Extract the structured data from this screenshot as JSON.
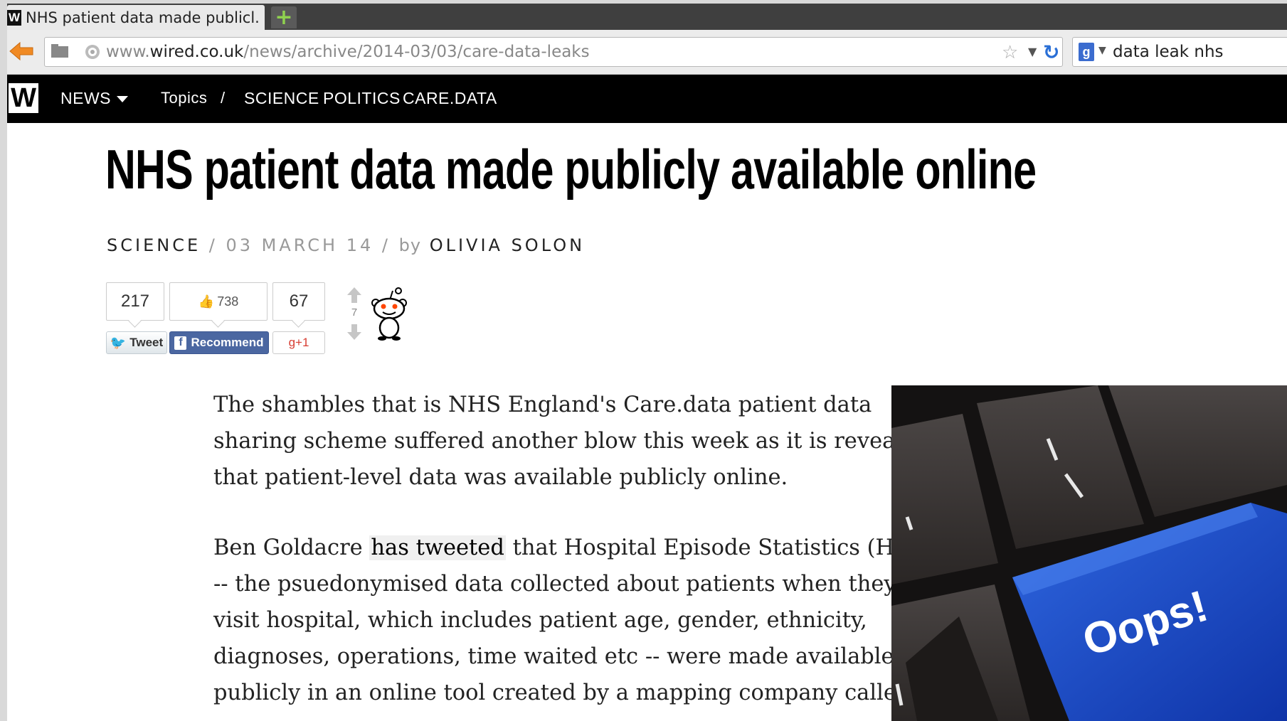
{
  "browser": {
    "tab_title": "NHS patient data made publicl...",
    "tab_favicon": "W",
    "new_tab_glyph": "+",
    "url_prefix": "www.",
    "url_domain": "wired.co.uk",
    "url_path": "/news/archive/2014-03/03/care-data-leaks",
    "search_engine_glyph": "g",
    "search_query": "data leak nhs"
  },
  "site": {
    "logo": "W",
    "nav": {
      "news": "NEWS",
      "topics": "Topics",
      "topics_sep": "/",
      "items": [
        "SCIENCE",
        "POLITICS",
        "CARE.DATA"
      ]
    }
  },
  "article": {
    "headline": "NHS patient data made publicly available online",
    "section": "SCIENCE",
    "sep": "/",
    "date": "03 MARCH 14",
    "by": "by",
    "author": "OLIVIA SOLON",
    "paragraphs": [
      {
        "lines": [
          "The shambles that is NHS England's Care.data patient data",
          "sharing scheme suffered another blow this week as it is revealed",
          "that patient-level data was available publicly online."
        ]
      },
      {
        "first_line": {
          "before": "Ben Goldacre ",
          "link": "has tweeted",
          "after": " that Hospital Episode Statistics (HES)"
        },
        "lines": [
          "-- the psuedonymised data collected about patients when they",
          "visit hospital, which includes patient age, gender, ethnicity,",
          "diagnoses, operations, time waited etc -- were made available",
          "publicly in an online tool created by a mapping company called"
        ]
      }
    ],
    "image_key_text": "Oops!"
  },
  "social": {
    "tweet_count": "217",
    "like_count": "738",
    "gplus_count": "67",
    "tweet_label": "Tweet",
    "recommend_label": "Recommend",
    "gplus_label": "g+1",
    "fb_glyph": "f",
    "reddit_score": "7"
  },
  "colors": {
    "site_bar": "#000000",
    "facebook": "#4b67a1",
    "twitter": "#2ea7e6",
    "key_blue": "#1f4fc4"
  }
}
